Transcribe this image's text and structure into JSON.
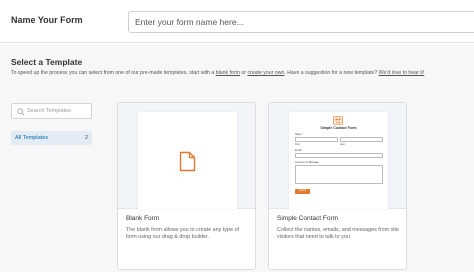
{
  "header": {
    "label": "Name Your Form",
    "placeholder": "Enter your form name here..."
  },
  "section": {
    "title": "Select a Template",
    "desc_before": "To speed up the process you can select from one of our pre-made templates, start with a ",
    "link_blank": "blank form",
    "desc_or": " or ",
    "link_create": "create your own",
    "desc_after": ". Have a suggestion for a new template? ",
    "link_suggest": "We'd love to hear it!"
  },
  "sidebar": {
    "search_placeholder": "Search Templates",
    "items": [
      {
        "label": "All Templates",
        "count": "2"
      }
    ]
  },
  "cards": [
    {
      "title": "Blank Form",
      "desc": "The blank form allows you to create any type of form using our drag & drop builder.",
      "icon": "document-icon"
    },
    {
      "title": "Simple Contact Form",
      "desc": "Collect the names, emails, and messages from site visitors that need to talk to you.",
      "preview": {
        "title": "Simple Contact Form",
        "name_label": "Name *",
        "first_label": "First",
        "last_label": "Last",
        "email_label": "Email *",
        "message_label": "Comment or Message",
        "submit_label": "Submit"
      }
    }
  ],
  "colors": {
    "accent": "#e27730",
    "link": "#036aab",
    "selected_bg": "#e3ecf5",
    "main_bg": "#f7f7f7"
  }
}
